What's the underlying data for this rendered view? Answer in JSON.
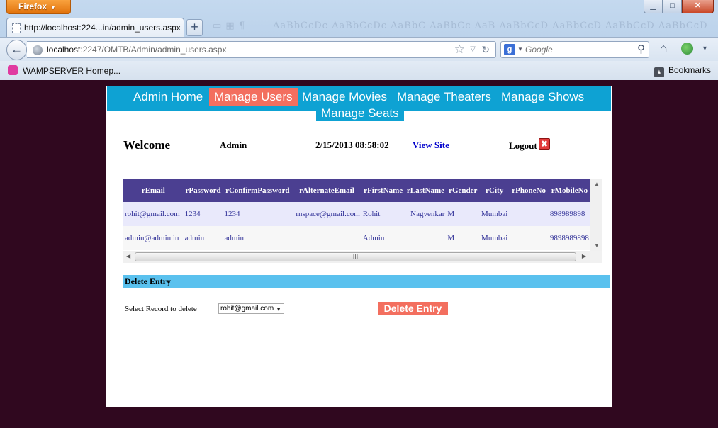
{
  "browser": {
    "app_button": "Firefox",
    "tab_title": "http://localhost:224...in/admin_users.aspx",
    "url_host": "localhost",
    "url_path": ":2247/OMTB/Admin/admin_users.aspx",
    "search_placeholder": "Google",
    "bookmark_item": "WAMPSERVER Homep...",
    "bookmarks_label": "Bookmarks"
  },
  "menu": {
    "items": [
      "Admin Home",
      "Manage Users",
      "Manage Movies",
      "Manage Theaters",
      "Manage Shows",
      "Manage Seats"
    ],
    "active": "Manage Users"
  },
  "header": {
    "welcome": "Welcome",
    "user": "Admin",
    "datetime": "2/15/2013 08:58:02",
    "view_site": "View Site",
    "logout": "Logout"
  },
  "grid": {
    "columns": [
      "rEmail",
      "rPassword",
      "rConfirmPassword",
      "rAlternateEmail",
      "rFirstName",
      "rLastName",
      "rGender",
      "rCity",
      "rPhoneNo",
      "rMobileNo"
    ],
    "rows": [
      [
        "rohit@gmail.com",
        "1234",
        "1234",
        "rnspace@gmail.com",
        "Rohit",
        "Nagvenkar",
        "M",
        "Mumbai",
        "",
        "898989898"
      ],
      [
        "admin@admin.in",
        "admin",
        "admin",
        "",
        "Admin",
        "",
        "M",
        "Mumbai",
        "",
        "9898989898"
      ]
    ],
    "hscroll_grip": "III"
  },
  "delete_section": {
    "title": "Delete Entry",
    "select_label": "Select Record to delete",
    "selected_record": "rohit@gmail.com",
    "button": "Delete Entry"
  },
  "colors": {
    "menu_bg": "#0ea2d3",
    "menu_active": "#f36f5f",
    "grid_header": "#4b3f91",
    "page_bg": "#30081f",
    "section_header": "#5ac1ee"
  }
}
